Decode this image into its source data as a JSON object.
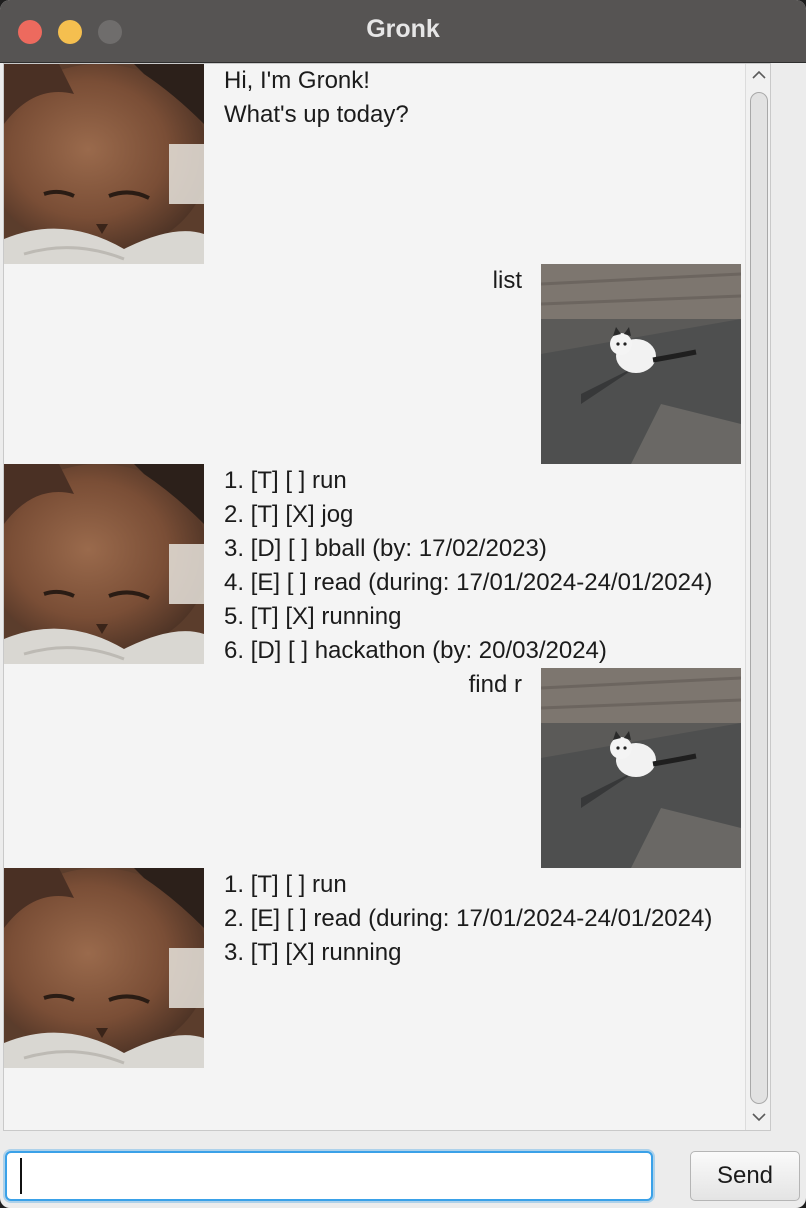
{
  "window": {
    "title": "Gronk"
  },
  "dialogs": [
    {
      "speaker": "bot",
      "avatar": "orange-cat-avatar",
      "lines": [
        "Hi, I'm Gronk!",
        "What's up today?"
      ]
    },
    {
      "speaker": "user",
      "avatar": "white-cat-avatar",
      "lines": [
        "list"
      ]
    },
    {
      "speaker": "bot",
      "avatar": "orange-cat-avatar",
      "lines": [
        "1. [T] [ ] run",
        "2. [T] [X] jog",
        "3. [D] [ ] bball (by: 17/02/2023)",
        "4. [E] [ ] read (during: 17/01/2024-24/01/2024)",
        "5. [T] [X] running",
        "6. [D] [ ] hackathon (by: 20/03/2024)"
      ]
    },
    {
      "speaker": "user",
      "avatar": "white-cat-avatar",
      "lines": [
        "find r"
      ]
    },
    {
      "speaker": "bot",
      "avatar": "orange-cat-avatar",
      "lines": [
        "1. [T] [ ] run",
        "2. [E] [ ] read (during: 17/01/2024-24/01/2024)",
        "3. [T] [X] running"
      ]
    }
  ],
  "input": {
    "value": "",
    "placeholder": ""
  },
  "send_button": {
    "label": "Send"
  },
  "colors": {
    "accent": "#3aa1e8",
    "titlebar": "#565453",
    "close": "#ed6a5e",
    "minimize": "#f5bf4f"
  },
  "icons": {
    "scroll_up": "chevron-up-icon",
    "scroll_down": "chevron-down-icon"
  }
}
